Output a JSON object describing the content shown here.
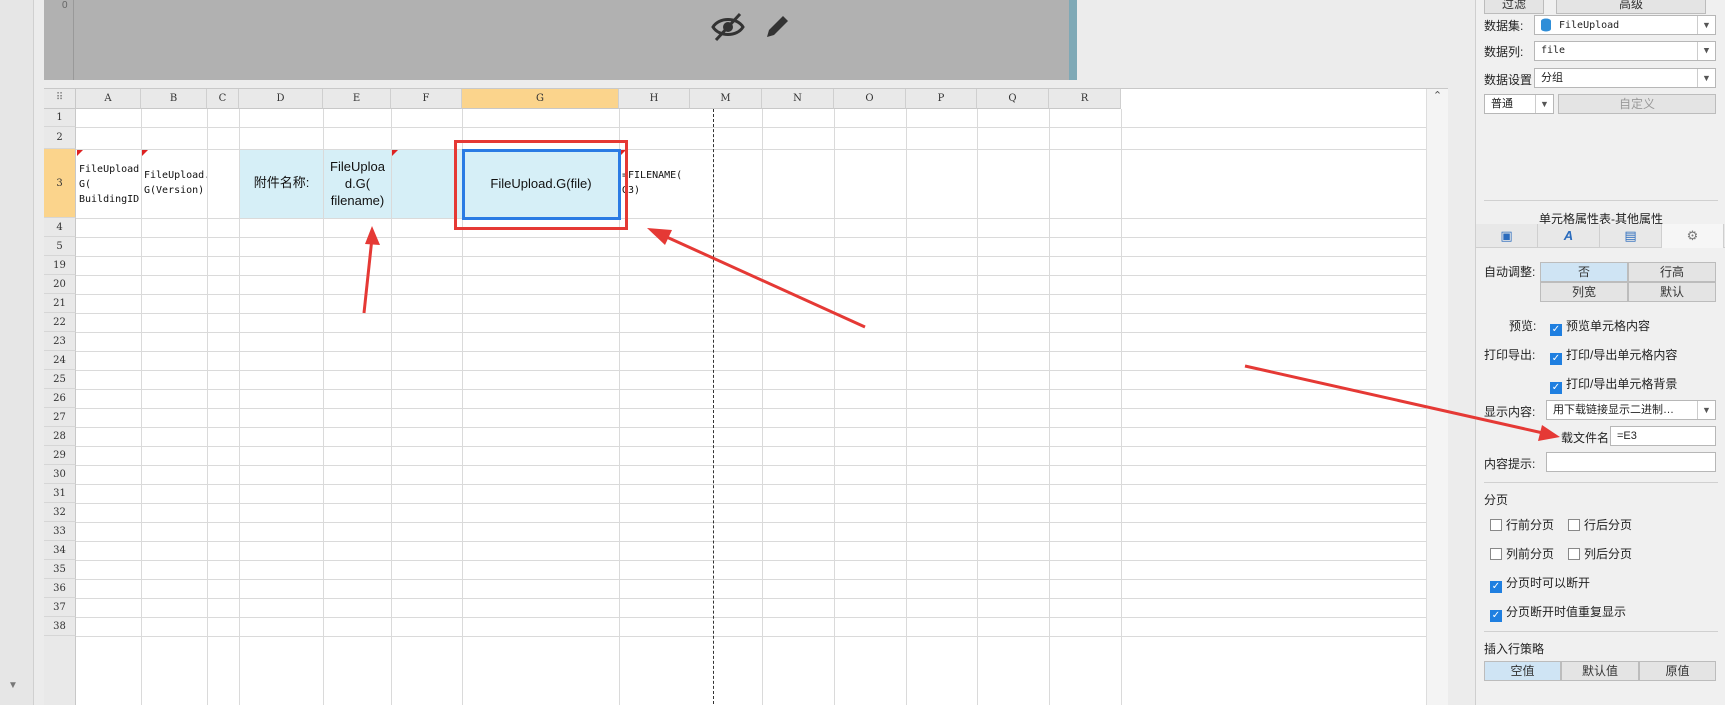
{
  "preview": {
    "ruler_label": "0",
    "hide_icon": "eye-slash-icon",
    "edit_icon": "pencil-icon"
  },
  "columns": [
    "A",
    "B",
    "C",
    "D",
    "E",
    "F",
    "G",
    "H",
    "M",
    "N",
    "O",
    "P",
    "Q",
    "R"
  ],
  "rows": [
    "1",
    "2",
    "3",
    "4",
    "5",
    "19",
    "20",
    "21",
    "22",
    "23",
    "24",
    "25",
    "26",
    "27",
    "28",
    "29",
    "30",
    "31",
    "32",
    "33",
    "34",
    "35",
    "36",
    "37",
    "38"
  ],
  "cells": {
    "a3": "FileUpload.\nG(\nBuildingID)",
    "b3": "FileUpload.\nG(Version)",
    "d3": "附件名称:",
    "e3": "FileUploa\nd.G(\nfilename)",
    "g3": "FileUpload.G(file)",
    "h3": "=FILENAME(\nG3)"
  },
  "panel": {
    "top_btn_filter": "过滤",
    "top_btn_advanced": "高级",
    "dataset_label": "数据集:",
    "dataset_value": "FileUpload",
    "column_label": "数据列:",
    "column_value": "file",
    "dataset_setting_label": "数据设置",
    "dataset_setting_value": "分组",
    "mode_value": "普通",
    "custom_label": "自定义",
    "section_title": "单元格属性表-其他属性",
    "auto_adjust_label": "自动调整:",
    "auto_no": "否",
    "auto_row_height": "行高",
    "auto_col_width": "列宽",
    "auto_default": "默认",
    "preview_label": "预览:",
    "preview_cell": "预览单元格内容",
    "print_label": "打印导出:",
    "print_content": "打印/导出单元格内容",
    "print_bg": "打印/导出单元格背景",
    "display_label": "显示内容:",
    "display_value": "用下载链接显示二进制…",
    "download_label": "载文件名",
    "download_value": "=E3",
    "tip_label": "内容提示:",
    "tip_value": "",
    "paging_title": "分页",
    "row_before": "行前分页",
    "row_after": "行后分页",
    "col_before": "列前分页",
    "col_after": "列后分页",
    "can_break": "分页时可以断开",
    "repeat_break": "分页断开时值重复显示",
    "insert_title": "插入行策略",
    "insert_empty": "空值",
    "insert_default": "默认值",
    "insert_original": "原值"
  },
  "colors": {
    "accent": "#2a7be4",
    "annotation": "#e53935",
    "selection_header": "#fbd48c",
    "cell_fill": "#d6eff7"
  }
}
